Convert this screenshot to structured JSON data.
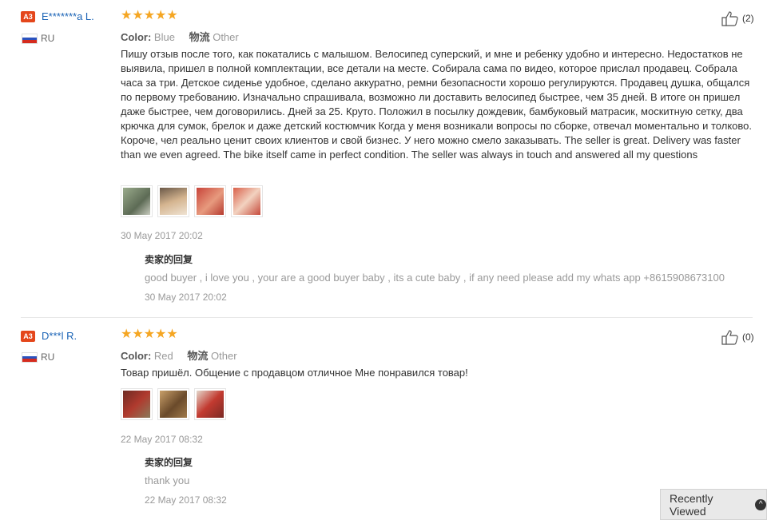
{
  "reviews": [
    {
      "badge": "A3",
      "username": "E*******a L.",
      "country": "RU",
      "rating": 5,
      "stars": "★★★★★",
      "color_label": "Color:",
      "color_value": "Blue",
      "logistics_label": "物流",
      "logistics_value": "Other",
      "text": "Пишу отзыв после того, как покатались с малышом. Велосипед суперский, и мне и ребенку удобно и интересно. Недостатков не выявила, пришел в полной комплектации, все детали на месте. Собирала сама по видео, которое прислал продавец. Собрала часа за три. Детское сиденье удобное, сделано аккуратно, ремни безопасности хорошо регулируются. Продавец душка, общался по первому требованию. Изначально спрашивала, возможно ли доставить велосипед быстрее, чем 35 дней. В итоге он пришел даже быстрее, чем договорились. Дней за 25. Круто. Положил в посылку дождевик, бамбуковый матрасик, москитную сетку, два крючка для сумок, брелок и даже детский костюмчик Когда у меня возникали вопросы по сборке, отвечал моментально и толково. Короче, чел реально ценит своих клиентов и свой бизнес. У него можно смело заказывать. The seller is great. Delivery was faster than we even agreed. The bike itself came in perfect condition. The seller was always in touch and answered all my questions",
      "photo_colors": [
        "#7a8a6e",
        "#b89a7a",
        "#c8443a",
        "#d9604a"
      ],
      "date": "30 May 2017 20:02",
      "reply_title": "卖家的回复",
      "reply_text": "good buyer , i love you , your are a good buyer baby , its a cute baby , if any need please add my whats app +8615908673100",
      "reply_date": "30 May 2017 20:02",
      "likes": "(2)"
    },
    {
      "badge": "A3",
      "username": "D***l R.",
      "country": "RU",
      "rating": 5,
      "stars": "★★★★★",
      "color_label": "Color:",
      "color_value": "Red",
      "logistics_label": "物流",
      "logistics_value": "Other",
      "text": "Товар пришёл. Общение с продавцом отличное Мне понравился товар!",
      "photo_colors": [
        "#b03a2e",
        "#a07a4a",
        "#c23a30"
      ],
      "date": "22 May 2017 08:32",
      "reply_title": "卖家的回复",
      "reply_text": "thank you",
      "reply_date": "22 May 2017 08:32",
      "likes": "(0)"
    }
  ],
  "recently_viewed": "Recently Viewed",
  "colors": {
    "badge": "#e4461b",
    "username": "#1a63b6",
    "star": "#f5a623"
  }
}
